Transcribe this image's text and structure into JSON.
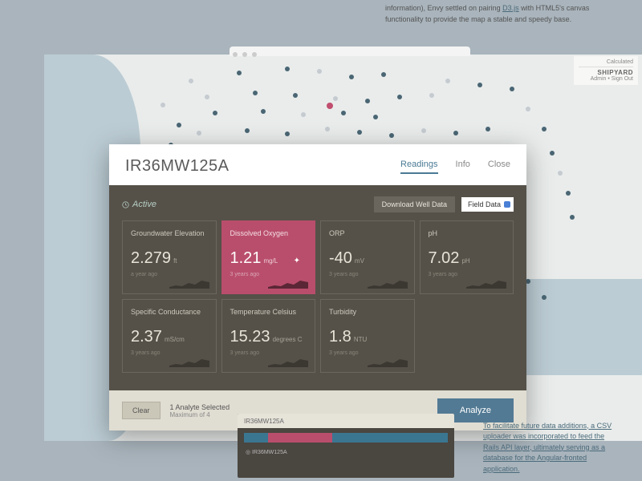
{
  "bgText": {
    "prefix": "information), Envy settled on pairing ",
    "link": "D3.js",
    "suffix": " with HTML5's canvas functionality to provide the map a stable and speedy base."
  },
  "topRight": {
    "calc": "Calculated",
    "brand": "SHIPYARD",
    "admin": "Admin • Sign Out"
  },
  "modal": {
    "title": "IR36MW125A",
    "tabs": {
      "readings": "Readings",
      "info": "Info",
      "close": "Close"
    },
    "status": "Active",
    "downloadBtn": "Download Well Data",
    "fieldBtn": "Field Data",
    "cards": [
      {
        "title": "Groundwater Elevation",
        "value": "2.279",
        "unit": "ft",
        "time": "a year ago"
      },
      {
        "title": "Dissolved Oxygen",
        "value": "1.21",
        "unit": "mg/L",
        "time": "3 years ago"
      },
      {
        "title": "ORP",
        "value": "-40",
        "unit": "mV",
        "time": "3 years ago"
      },
      {
        "title": "pH",
        "value": "7.02",
        "unit": "pH",
        "time": "3 years ago"
      },
      {
        "title": "Specific Conductance",
        "value": "2.37",
        "unit": "mS/cm",
        "time": "3 years ago"
      },
      {
        "title": "Temperature Celsius",
        "value": "15.23",
        "unit": "degrees C",
        "time": "3 years ago"
      },
      {
        "title": "Turbidity",
        "value": "1.8",
        "unit": "NTU",
        "time": "3 years ago"
      }
    ],
    "footer": {
      "clear": "Clear",
      "selected": "1 Analyte Selected",
      "max": "Maximum of 4",
      "analyze": "Analyze"
    }
  },
  "mini": {
    "title": "IR36MW125A",
    "row": "◎ IR36MW125A"
  },
  "brText": {
    "t1": "To facilitate future data additions, a CSV uploader was incorporated to feed the Rails API layer, ultimately serving as a database for the ",
    "link": "Angular",
    "t2": "-fronted application."
  }
}
